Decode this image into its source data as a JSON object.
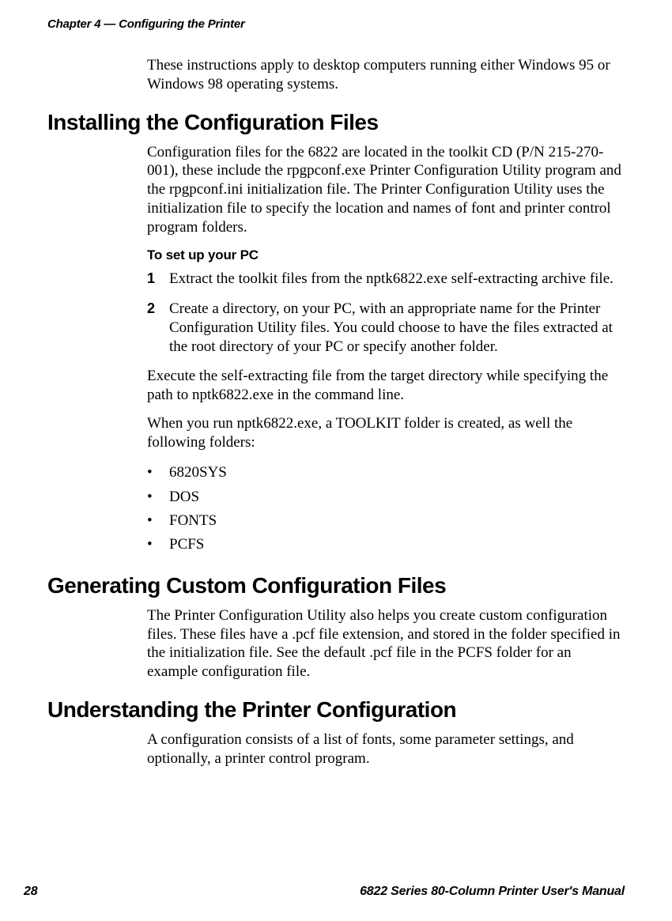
{
  "header": {
    "chapter_line": "Chapter 4 — Configuring the Printer"
  },
  "intro": "These instructions apply to desktop computers running either Windows 95 or Windows 98 operating systems.",
  "section1": {
    "heading": "Installing the Configuration Files",
    "para": "Configuration files for the 6822 are located in the toolkit CD (P/N 215-270-001), these include the rpgpconf.exe Printer Configuration Utility program and the rpgpconf.ini initialization file. The Printer Configuration Utility uses the initialization file to specify the location and names of font and printer control program folders.",
    "subhead": "To set up your PC",
    "steps": [
      "Extract the toolkit files from the nptk6822.exe self-extracting archive file.",
      "Create a directory, on your PC, with an appropriate name for the Printer Configuration Utility files. You could choose to have the files extracted at the root directory of your PC or specify another folder."
    ],
    "para2": "Execute the self-extracting file from the target directory while specifying the path to nptk6822.exe in the command line.",
    "para3": "When you run nptk6822.exe, a TOOLKIT folder is created, as well the following folders:",
    "folders": [
      "6820SYS",
      "DOS",
      "FONTS",
      "PCFS"
    ]
  },
  "section2": {
    "heading": "Generating Custom Configuration Files",
    "para": "The Printer Configuration Utility also helps you create custom configuration files. These files have a .pcf file extension, and stored in the folder specified in the initialization file. See the default .pcf file in the PCFS folder for an example configuration file."
  },
  "section3": {
    "heading": "Understanding the Printer Configuration",
    "para": "A configuration consists of a list of fonts, some parameter settings, and optionally, a printer control program."
  },
  "footer": {
    "page_number": "28",
    "doc_title": "6822 Series 80-Column Printer User's Manual"
  }
}
